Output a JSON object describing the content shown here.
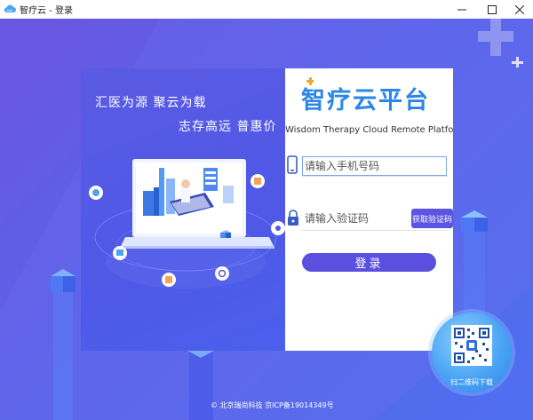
{
  "window": {
    "title": "智疗云 - 登录",
    "minimize_glyph": "—",
    "maximize_glyph": "☐",
    "close_glyph": "✕"
  },
  "slogan": {
    "line1": "汇医为源  聚云为载",
    "line2": "志存高远  普惠价"
  },
  "brand": {
    "name": "智疗云平台",
    "subtitle": "Wisdom Therapy Cloud Remote Platform",
    "color": "#2b86e6"
  },
  "login_form": {
    "phone_placeholder": "请输入手机号码",
    "code_placeholder": "请输入验证码",
    "get_code_label": "获取验证码",
    "login_label": "登录"
  },
  "footer": {
    "copyright": "© 北京瑞尚科技 京ICP备19014349号"
  },
  "qr": {
    "label": "扫二维码下载"
  },
  "colors": {
    "background": "#5a63e6",
    "button": "#5b4fe0",
    "input_border": "#7aa6e8",
    "qr_badge": "#4aa3f5"
  },
  "icons": {
    "app": "cloud-icon",
    "phone": "phone-icon",
    "lock": "lock-icon"
  }
}
